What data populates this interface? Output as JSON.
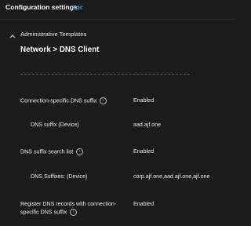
{
  "header": {
    "title": "Configuration settings",
    "edit_label": "Edit"
  },
  "section": {
    "title": "Administrative Templates"
  },
  "page": {
    "heading": "Network > DNS Client"
  },
  "settings": [
    {
      "label": "Connection-specific DNS suffix",
      "value": "Enabled",
      "info_icon": "info-icon"
    },
    {
      "label": "DNS suffix (Device)",
      "value": "aad.ajf.one"
    },
    {
      "label": "DNS suffix search list",
      "value": "Enabled",
      "info_icon": "info-icon"
    },
    {
      "label": "DNS Suffixes: (Device)",
      "value": "corp.ajf.one,aad.ajf.one,ajf.one"
    },
    {
      "label_line1": "Register DNS records with connection-",
      "label_line2": "specific DNS suffix",
      "value": "Enabled",
      "info_icon": "info-icon"
    }
  ],
  "colors": {
    "background": "#1b1b1b",
    "link": "#5ea4ee",
    "text": "#e8e8e8"
  }
}
